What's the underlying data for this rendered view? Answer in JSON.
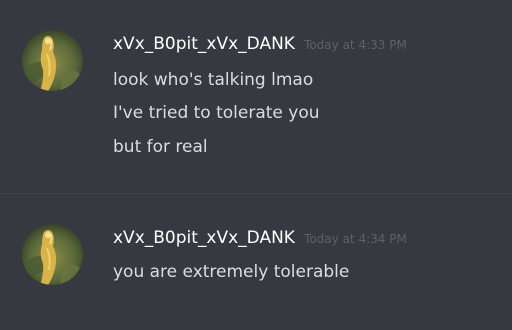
{
  "theme": {
    "background": "#36393f",
    "username_color": "#fefefe",
    "message_color": "#dcddde",
    "timestamp_color": "#5d6168",
    "divider_color": "#5a3a40"
  },
  "messages": [
    {
      "author": "xVx_B0pit_xVx_DANK",
      "timestamp": "Today at 4:33 PM",
      "avatar_icon": "golden-figure-avatar",
      "lines": [
        "look who's talking lmao",
        "I've tried to tolerate you",
        "but for real"
      ]
    },
    {
      "author": "xVx_B0pit_xVx_DANK",
      "timestamp": "Today at 4:34 PM",
      "avatar_icon": "golden-figure-avatar",
      "lines": [
        "you are extremely tolerable"
      ]
    }
  ]
}
